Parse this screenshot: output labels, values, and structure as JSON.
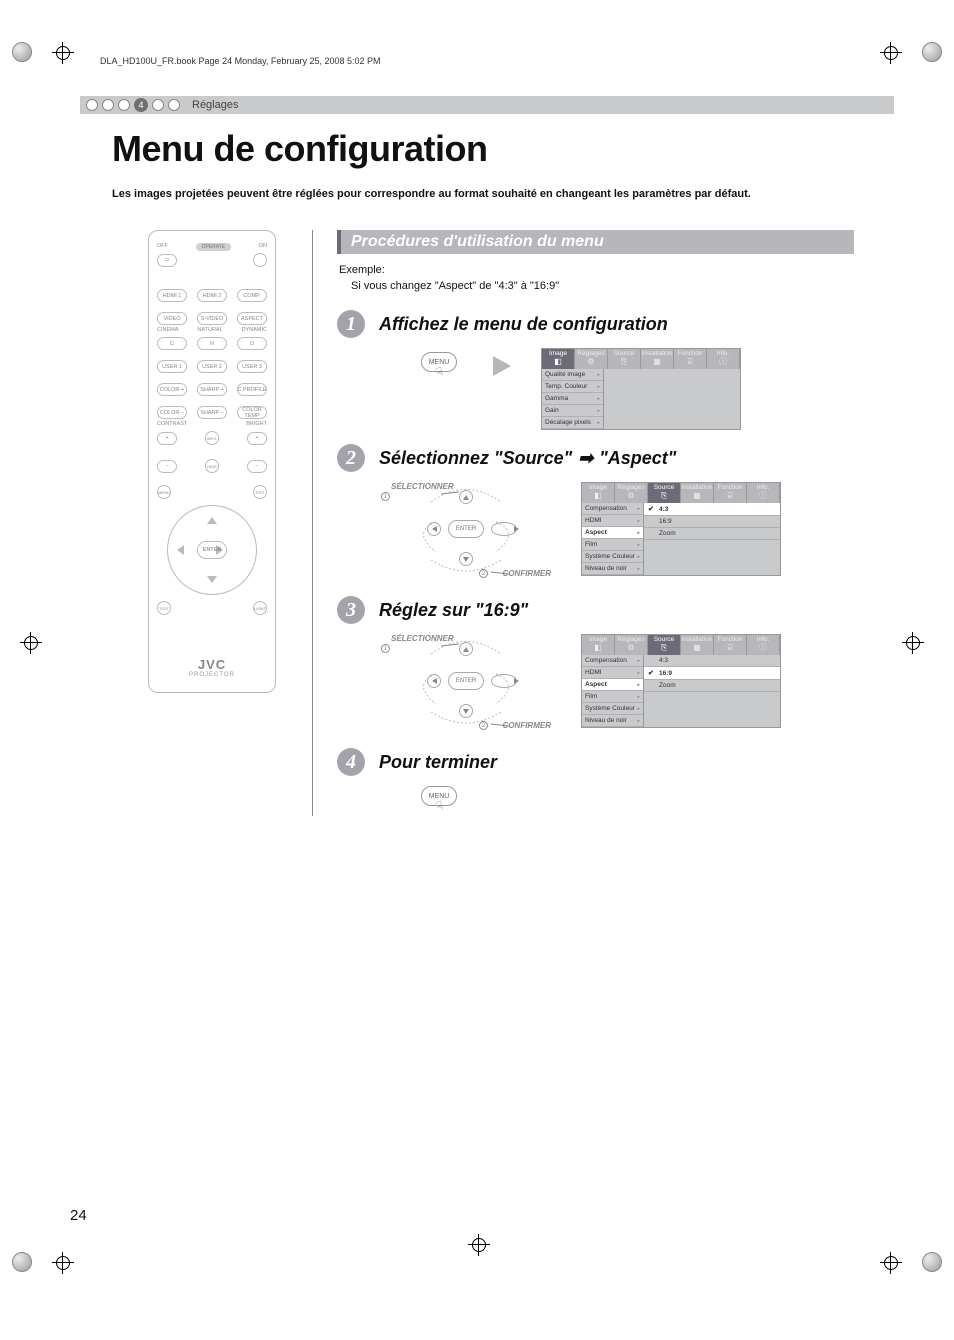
{
  "pageinfo": "DLA_HD100U_FR.book  Page 24  Monday, February 25, 2008  5:02 PM",
  "breadcrumb": {
    "num": "4",
    "label": "Réglages"
  },
  "title": "Menu de configuration",
  "intro": "Les images projetées peuvent être réglées pour correspondre au format souhaité en changeant les paramètres par défaut.",
  "section_bar": "Procédures d'utilisation du menu",
  "example_label": "Exemple:",
  "example_text": "Si vous changez \"Aspect\" de \"4:3\" à \"16:9\"",
  "steps": {
    "s1": {
      "num": "1",
      "title": "Affichez le menu de configuration"
    },
    "s2": {
      "num": "2",
      "title_a": "Sélectionnez \"Source\"",
      "title_b": "\"Aspect\""
    },
    "s3": {
      "num": "3",
      "title": "Réglez sur \"16:9\""
    },
    "s4": {
      "num": "4",
      "title": "Pour terminer"
    }
  },
  "cluster": {
    "select": "SÉLECTIONNER",
    "confirm": "CONFIRMER",
    "enter": "ENTER",
    "c1": "1",
    "c2": "2"
  },
  "menubtn": "MENU",
  "osd_tabs": [
    "Image",
    "Réglages",
    "Source",
    "Installation",
    "Fonction",
    "Info."
  ],
  "osd1": {
    "active_tab": 0,
    "items": [
      "Qualité image",
      "Temp. Couleur",
      "Gamma",
      "Gain",
      "Décalage pixels"
    ]
  },
  "osd2": {
    "active_tab": 2,
    "items": [
      "Compensation",
      "HDMI",
      "Aspect",
      "Film",
      "Système Couleur",
      "Niveau de noir"
    ],
    "selected_item": 2,
    "values": [
      "4:3",
      "16:9",
      "Zoom"
    ],
    "checked_value": 0
  },
  "osd3": {
    "active_tab": 2,
    "items": [
      "Compensation",
      "HDMI",
      "Aspect",
      "Film",
      "Système Couleur",
      "Niveau de noir"
    ],
    "selected_item": 2,
    "values": [
      "4:3",
      "16:9",
      "Zoom"
    ],
    "checked_value": 1
  },
  "remote": {
    "off": "OFF",
    "on": "ON",
    "operate": "OPERATE",
    "row1": [
      "HDMI 1",
      "HDMI 2",
      "COMP."
    ],
    "row2": [
      "VIDEO",
      "S-VIDEO",
      "ASPECT"
    ],
    "row3_lbl": [
      "CINEMA",
      "NATURAL",
      "DYNAMIC"
    ],
    "row3": [
      "C",
      "N",
      "D"
    ],
    "row4": [
      "USER 1",
      "USER 2",
      "USER 3"
    ],
    "row5": [
      "COLOR +",
      "SHARP +",
      "C.PROFILE"
    ],
    "row6": [
      "COLOR −",
      "SHARP −",
      "COLOR TEMP"
    ],
    "cb_lbl": [
      "CONTRAST",
      "",
      "BRIGHT"
    ],
    "info": "INFO.",
    "hide": "HIDE",
    "menu": "MENU",
    "exit": "EXIT",
    "test": "TEST",
    "light": "LIGHT",
    "enter": "ENTER",
    "brand": "JVC",
    "sub": "PROJECTOR"
  },
  "pagenum": "24"
}
